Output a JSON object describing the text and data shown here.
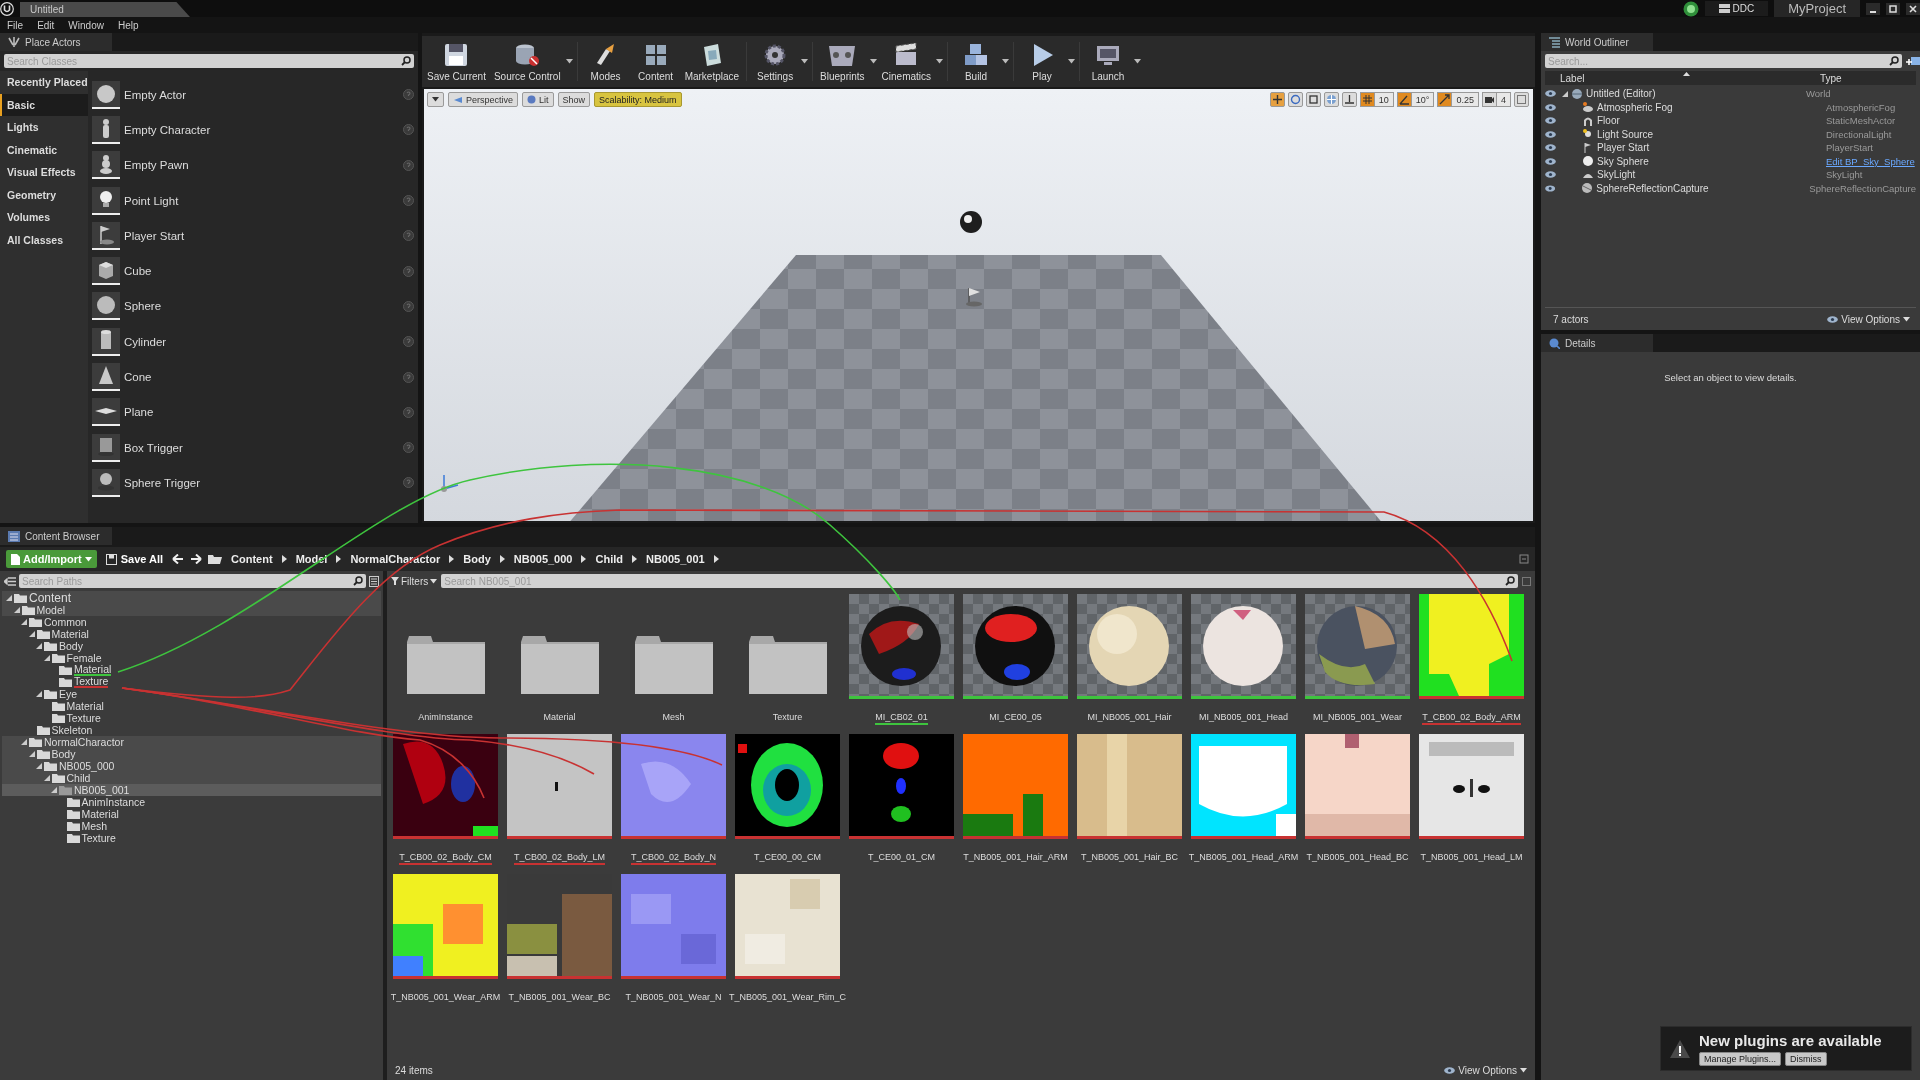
{
  "title_bar": {
    "tab": "Untitled",
    "ddc": "DDC",
    "project": "MyProject"
  },
  "menu": [
    "File",
    "Edit",
    "Window",
    "Help"
  ],
  "place_actors": {
    "tab": "Place Actors",
    "search": {
      "placeholder": "Search Classes"
    },
    "categories": [
      {
        "label": "Recently Placed",
        "selected": false
      },
      {
        "label": "Basic",
        "selected": true
      },
      {
        "label": "Lights",
        "selected": false
      },
      {
        "label": "Cinematic",
        "selected": false
      },
      {
        "label": "Visual Effects",
        "selected": false
      },
      {
        "label": "Geometry",
        "selected": false
      },
      {
        "label": "Volumes",
        "selected": false
      },
      {
        "label": "All Classes",
        "selected": false
      }
    ],
    "items": [
      "Empty Actor",
      "Empty Character",
      "Empty Pawn",
      "Point Light",
      "Player Start",
      "Cube",
      "Sphere",
      "Cylinder",
      "Cone",
      "Plane",
      "Box Trigger",
      "Sphere Trigger"
    ]
  },
  "toolbar": [
    {
      "label": "Save Current",
      "dropdown": false
    },
    {
      "label": "Source Control",
      "dropdown": true
    },
    {
      "label": "Modes",
      "dropdown": false
    },
    {
      "label": "Content",
      "dropdown": false
    },
    {
      "label": "Marketplace",
      "dropdown": false
    },
    {
      "label": "Settings",
      "dropdown": true
    },
    {
      "label": "Blueprints",
      "dropdown": true
    },
    {
      "label": "Cinematics",
      "dropdown": true
    },
    {
      "label": "Build",
      "dropdown": true
    },
    {
      "label": "Play",
      "dropdown": true
    },
    {
      "label": "Launch",
      "dropdown": true
    }
  ],
  "viewport": {
    "view_buttons": [
      "Perspective",
      "Lit",
      "Show"
    ],
    "scalability": "Scalability: Medium",
    "transform_tools": [
      {
        "selected": true
      },
      {
        "selected": false
      },
      {
        "selected": false
      },
      {
        "selected": false
      },
      {
        "selected": false
      }
    ],
    "snaps": [
      {
        "value": "10",
        "on": true
      },
      {
        "value": "10°",
        "on": true
      },
      {
        "value": "0.25",
        "on": true
      }
    ],
    "camera_speed": "4"
  },
  "world_outliner": {
    "tab": "World Outliner",
    "search": {
      "placeholder": "Search..."
    },
    "columns": [
      "Label",
      "Type"
    ],
    "rows": [
      {
        "label": "Untitled (Editor)",
        "type": "World",
        "type_link": false,
        "expanded": true,
        "children": [
          {
            "label": "Atmospheric Fog",
            "type": "AtmosphericFog",
            "type_link": false
          },
          {
            "label": "Floor",
            "type": "StaticMeshActor",
            "type_link": false
          },
          {
            "label": "Light Source",
            "type": "DirectionalLight",
            "type_link": false
          },
          {
            "label": "Player Start",
            "type": "PlayerStart",
            "type_link": false
          },
          {
            "label": "Sky Sphere",
            "type": "Edit BP_Sky_Sphere",
            "type_link": true
          },
          {
            "label": "SkyLight",
            "type": "SkyLight",
            "type_link": false
          },
          {
            "label": "SphereReflectionCapture",
            "type": "SphereReflectionCapture",
            "type_link": false
          }
        ]
      }
    ],
    "footer": "7 actors",
    "view_options": "View Options"
  },
  "details": {
    "tab": "Details",
    "message": "Select an object to view details."
  },
  "content_browser": {
    "tab": "Content Browser",
    "add_import": "Add/Import",
    "save_all": "Save All",
    "breadcrumbs": [
      "Content",
      "Model",
      "NormalCharactor",
      "Body",
      "NB005_000",
      "Child",
      "NB005_001"
    ],
    "path_search": {
      "placeholder": "Search Paths"
    },
    "tree": [
      {
        "label": "Content",
        "expanded": true,
        "selected": false,
        "highlighted": true,
        "children": [
          {
            "label": "Model",
            "expanded": true,
            "selected": false,
            "highlighted": true,
            "children": [
              {
                "label": "Common",
                "expanded": true,
                "selected": false,
                "highlighted": false,
                "children": [
                  {
                    "label": "Material",
                    "expanded": true,
                    "selected": false,
                    "highlighted": false,
                    "children": [
                      {
                        "label": "Body",
                        "expanded": true,
                        "selected": false,
                        "highlighted": false,
                        "children": [
                          {
                            "label": "Female",
                            "expanded": true,
                            "selected": false,
                            "highlighted": false,
                            "children": [
                              {
                                "label": "Material",
                                "selected": false,
                                "highlighted": false,
                                "color": "#3ec43e"
                              },
                              {
                                "label": "Texture",
                                "selected": false,
                                "highlighted": false,
                                "color": "#c83232"
                              }
                            ]
                          }
                        ]
                      },
                      {
                        "label": "Eye",
                        "expanded": true,
                        "selected": false,
                        "highlighted": false,
                        "children": [
                          {
                            "label": "Material",
                            "selected": false,
                            "highlighted": false
                          },
                          {
                            "label": "Texture",
                            "selected": false,
                            "highlighted": false
                          }
                        ]
                      }
                    ]
                  },
                  {
                    "label": "Skeleton",
                    "selected": false,
                    "highlighted": false
                  }
                ]
              },
              {
                "label": "NormalCharactor",
                "expanded": true,
                "selected": false,
                "highlighted": true,
                "children": [
                  {
                    "label": "Body",
                    "expanded": true,
                    "selected": false,
                    "highlighted": true,
                    "children": [
                      {
                        "label": "NB005_000",
                        "expanded": true,
                        "selected": false,
                        "highlighted": true,
                        "children": [
                          {
                            "label": "Child",
                            "expanded": true,
                            "selected": false,
                            "highlighted": true,
                            "children": [
                              {
                                "label": "NB005_001",
                                "expanded": true,
                                "selected": true,
                                "children": [
                                  {
                                    "label": "AnimInstance",
                                    "selected": false,
                                    "highlighted": false
                                  },
                                  {
                                    "label": "Material",
                                    "selected": false,
                                    "highlighted": false
                                  },
                                  {
                                    "label": "Mesh",
                                    "selected": false,
                                    "highlighted": false
                                  },
                                  {
                                    "label": "Texture",
                                    "selected": false,
                                    "highlighted": false
                                  }
                                ]
                              }
                            ]
                          }
                        ]
                      }
                    ]
                  }
                ]
              }
            ]
          }
        ]
      }
    ],
    "filters": "Filters",
    "asset_search": {
      "placeholder": "Search NB005_001"
    },
    "assets": [
      {
        "kind": "folder",
        "name": "AnimInstance"
      },
      {
        "kind": "folder",
        "name": "Material"
      },
      {
        "kind": "folder",
        "name": "Mesh"
      },
      {
        "kind": "folder",
        "name": "Texture"
      },
      {
        "kind": "material",
        "name": "MI_CB02_01",
        "color": "#3ec43e"
      },
      {
        "kind": "material",
        "name": "MI_CE00_05"
      },
      {
        "kind": "material",
        "name": "MI_NB005_001_Hair"
      },
      {
        "kind": "material",
        "name": "MI_NB005_001_Head"
      },
      {
        "kind": "material",
        "name": "MI_NB005_001_Wear"
      },
      {
        "kind": "texture",
        "name": "T_CB00_02_Body_ARM",
        "color": "#c83232"
      },
      {
        "kind": "texture",
        "name": "T_CB00_02_Body_CM",
        "color": "#c83232"
      },
      {
        "kind": "texture",
        "name": "T_CB00_02_Body_LM",
        "color": "#c83232"
      },
      {
        "kind": "texture",
        "name": "T_CB00_02_Body_N",
        "color": "#c83232"
      },
      {
        "kind": "texture",
        "name": "T_CE00_00_CM"
      },
      {
        "kind": "texture",
        "name": "T_CE00_01_CM"
      },
      {
        "kind": "texture",
        "name": "T_NB005_001_Hair_ARM"
      },
      {
        "kind": "texture",
        "name": "T_NB005_001_Hair_BC"
      },
      {
        "kind": "texture",
        "name": "T_NB005_001_Head_ARM"
      },
      {
        "kind": "texture",
        "name": "T_NB005_001_Head_BC"
      },
      {
        "kind": "texture",
        "name": "T_NB005_001_Head_LM"
      },
      {
        "kind": "texture",
        "name": "T_NB005_001_Wear_ARM"
      },
      {
        "kind": "texture",
        "name": "T_NB005_001_Wear_BC"
      },
      {
        "kind": "texture",
        "name": "T_NB005_001_Wear_N"
      },
      {
        "kind": "texture",
        "name": "T_NB005_001_Wear_Rim_C"
      }
    ],
    "count": "24 items",
    "view_options": "View Options"
  },
  "annotations": [
    {
      "color": "#3ec43e"
    },
    {
      "color": "#c83232"
    },
    {
      "color": "#c83232"
    },
    {
      "color": "#c83232"
    },
    {
      "color": "#c83232"
    }
  ],
  "notification": {
    "message": "New plugins are available",
    "buttons": [
      "Manage Plugins...",
      "Dismiss"
    ]
  }
}
